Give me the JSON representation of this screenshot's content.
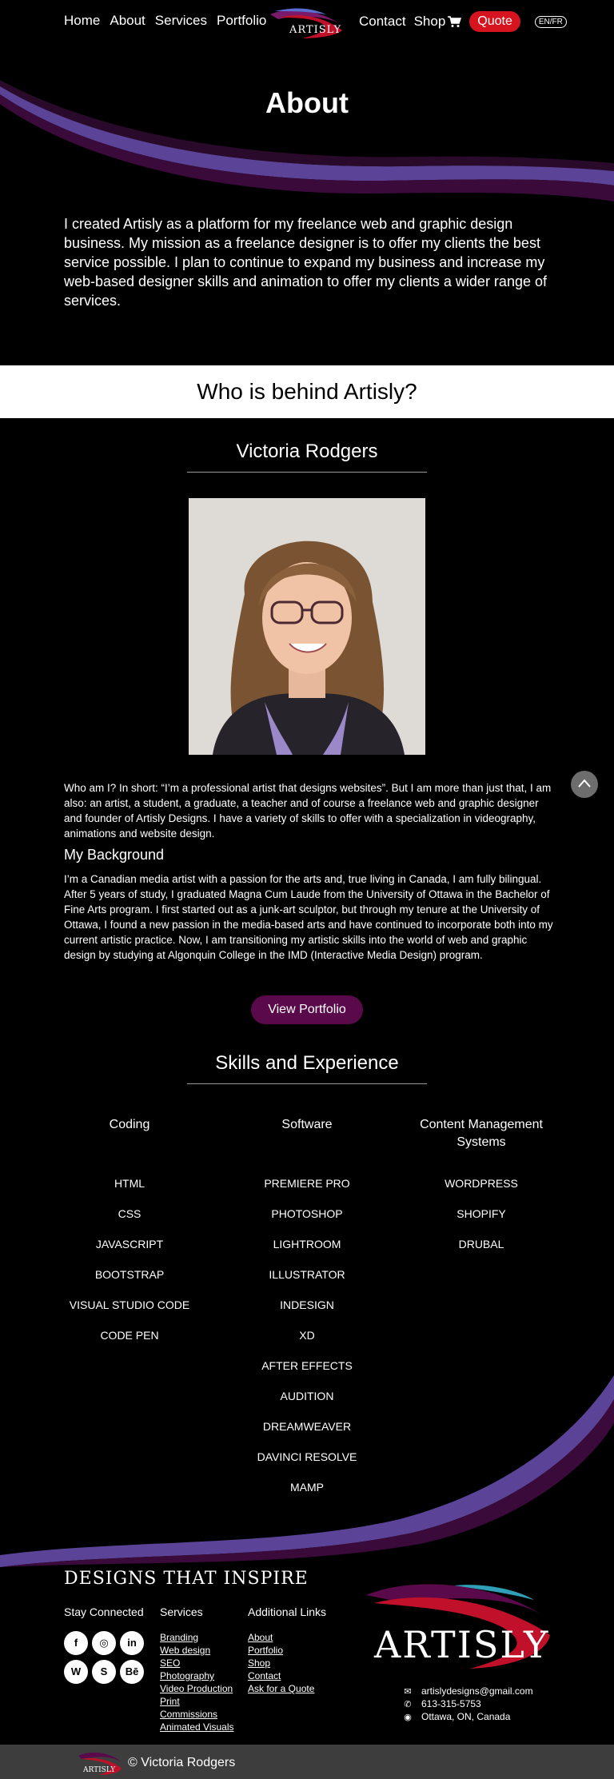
{
  "nav": {
    "left_items": [
      "Home",
      "About",
      "Services",
      "Portfolio"
    ],
    "contact": "Contact",
    "shop": "Shop",
    "quote": "Quote",
    "lang": "EN/FR",
    "logo_text": "ARTISLY"
  },
  "hero": {
    "title": "About",
    "text": "I created Artisly as a platform for my freelance web and graphic design business. My mission as a freelance designer is to offer my clients the best service possible. I plan to continue to expand my business and increase my web-based designer skills and animation to offer my clients a wider range of services."
  },
  "who": {
    "band_title": "Who is behind Artisly?",
    "name": "Victoria Rodgers",
    "intro": "Who am I? In short: “I’m a professional artist that designs websites”. But I am more than just that, I am also: an artist, a student, a graduate, a teacher and of course a freelance web and graphic designer and founder of Artisly Designs. I have a variety of skills to offer with a specialization in videography, animations and website design.",
    "background_heading": "My Background",
    "background": "I’m a Canadian media artist with a passion for the arts and, true living in Canada, I am fully bilingual. After 5 years of study, I graduated Magna Cum Laude from the University of Ottawa in the Bachelor of Fine Arts program.  I first started out as a junk-art sculptor, but through my tenure at the University of Ottawa, I found a new passion in the media-based arts and have continued to incorporate both into my current artistic practice. Now, I am transitioning my artistic skills into the world of web and graphic design by studying at Algonquin College in the IMD (Interactive Media Design) program.",
    "portfolio_button": "View Portfolio"
  },
  "skills": {
    "title": "Skills and Experience",
    "columns": [
      {
        "heading": "Coding",
        "items": [
          "HTML",
          "CSS",
          "JAVASCRIPT",
          "BOOTSTRAP",
          "VISUAL STUDIO CODE",
          "CODE PEN"
        ]
      },
      {
        "heading": "Software",
        "items": [
          "PREMIERE PRO",
          "PHOTOSHOP",
          "LIGHTROOM",
          "ILLUSTRATOR",
          "INDESIGN",
          "XD",
          "AFTER EFFECTS",
          "AUDITION",
          "DREAMWEAVER",
          "DAVINCI RESOLVE",
          "MAMP"
        ]
      },
      {
        "heading": "Content Management Systems",
        "items": [
          "WORDPRESS",
          "SHOPIFY",
          "DRUBAL"
        ]
      }
    ]
  },
  "footer": {
    "tagline": "DESIGNS THAT INSPIRE",
    "stay_connected": "Stay Connected",
    "services_heading": "Services",
    "services": [
      "Branding",
      "Web design",
      "SEO",
      "Photography",
      "Video Production",
      "Print",
      "Commissions",
      "Animated Visuals"
    ],
    "links_heading": "Additional Links",
    "links": [
      "About",
      "Portfolio",
      "Shop",
      "Contact",
      "Ask for a Quote"
    ],
    "social_icons": [
      "facebook-icon",
      "instagram-icon",
      "linkedin-icon",
      "wordpress-icon",
      "shopify-icon",
      "behance-icon"
    ],
    "logo_text": "ARTISLY",
    "email": "artislydesigns@gmail.com",
    "phone": "613-315-5753",
    "location": "Ottawa, ON, Canada",
    "copyright": "© Victoria Rodgers"
  },
  "colors": {
    "accent_purple": "#6a4fa3",
    "dark_purple": "#3a0a3a",
    "quote_red": "#d6141f",
    "button_plum": "#5a0a4a"
  }
}
